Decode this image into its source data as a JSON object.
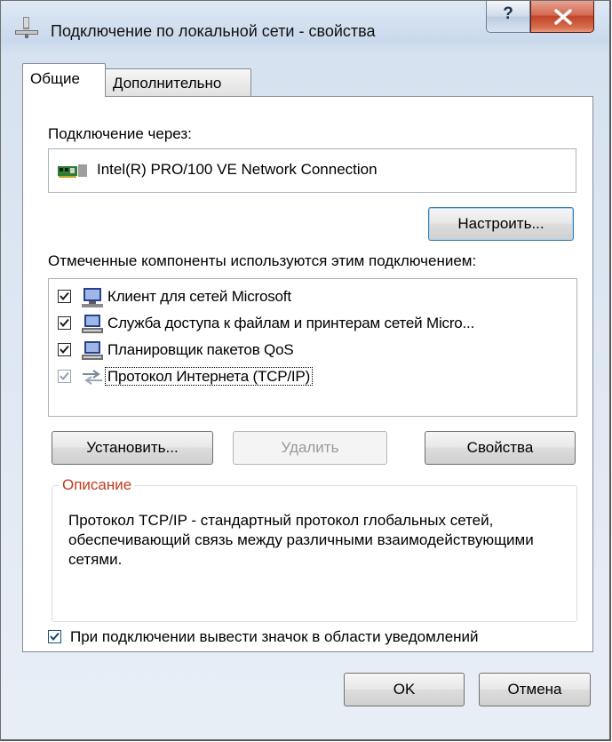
{
  "window": {
    "title": "Подключение по локальной сети - свойства",
    "help_label": "?",
    "close_label": "X"
  },
  "tabs": [
    {
      "label": "Общие",
      "active": true
    },
    {
      "label": "Дополнительно",
      "active": false
    }
  ],
  "connection": {
    "label": "Подключение через:",
    "adapter": "Intel(R) PRO/100 VE Network Connection",
    "configure_button": "Настроить..."
  },
  "components": {
    "label": "Отмеченные компоненты используются этим подключением:",
    "items": [
      {
        "label": "Клиент для сетей Microsoft",
        "checked": true,
        "icon": "network-client-icon"
      },
      {
        "label": "Служба доступа к файлам и принтерам сетей Micro...",
        "checked": true,
        "icon": "network-service-icon"
      },
      {
        "label": "Планировщик пакетов QoS",
        "checked": true,
        "icon": "network-service-icon"
      },
      {
        "label": "Протокол Интернета (TCP/IP)",
        "checked": true,
        "icon": "network-protocol-icon",
        "selected": true
      }
    ]
  },
  "actions": {
    "install": "Установить...",
    "remove": "Удалить",
    "properties": "Свойства"
  },
  "description": {
    "title": "Описание",
    "text": "Протокол TCP/IP - стандартный протокол глобальных сетей, обеспечивающий связь между различными взаимодействующими сетями."
  },
  "notify": {
    "label": "При подключении вывести значок в области уведомлений",
    "checked": true
  },
  "footer": {
    "ok": "OK",
    "cancel": "Отмена"
  }
}
